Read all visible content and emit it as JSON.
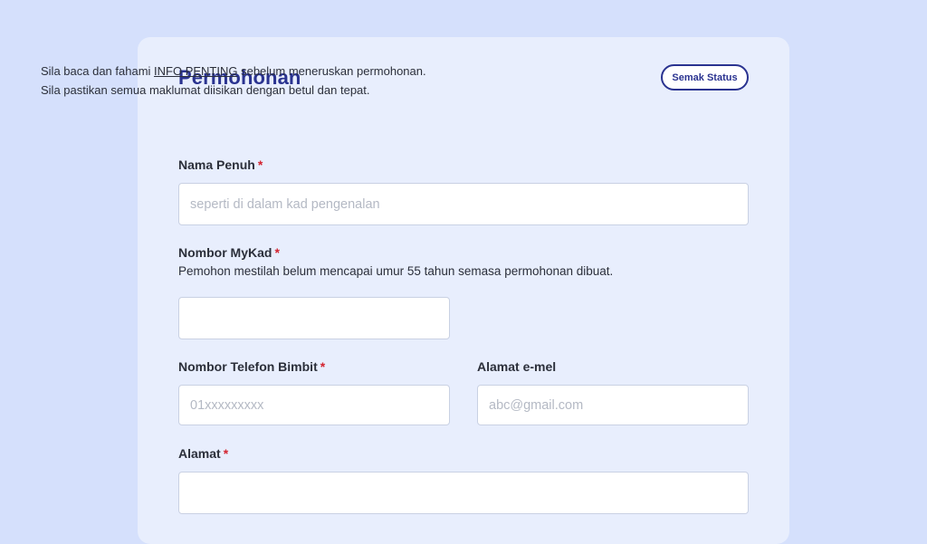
{
  "form": {
    "title": "Permohonan",
    "status_button": "Semak Status",
    "intro": {
      "line1_pre": "Sila baca dan fahami ",
      "line1_link": "INFO PENTING",
      "line1_post": " sebelum meneruskan permohonan.",
      "line2": "Sila pastikan semua maklumat diisikan dengan betul dan tepat."
    },
    "required_marker": "*",
    "fields": {
      "full_name": {
        "label": "Nama Penuh",
        "required": true,
        "placeholder": "seperti di dalam kad pengenalan",
        "value": ""
      },
      "mykad": {
        "label": "Nombor MyKad",
        "required": true,
        "hint": "Pemohon mestilah belum mencapai umur 55 tahun semasa permohonan dibuat.",
        "placeholder": "",
        "value": ""
      },
      "phone": {
        "label": "Nombor Telefon Bimbit",
        "required": true,
        "placeholder": "01xxxxxxxxx",
        "value": ""
      },
      "email": {
        "label": "Alamat e-mel",
        "required": false,
        "placeholder": "abc@gmail.com",
        "value": ""
      },
      "address": {
        "label": "Alamat",
        "required": true,
        "placeholder": "",
        "value": ""
      }
    }
  },
  "colors": {
    "page_background": "#d5e0fc",
    "card_background": "#e8eefd",
    "accent": "#2a3390",
    "required": "#d3232f"
  }
}
